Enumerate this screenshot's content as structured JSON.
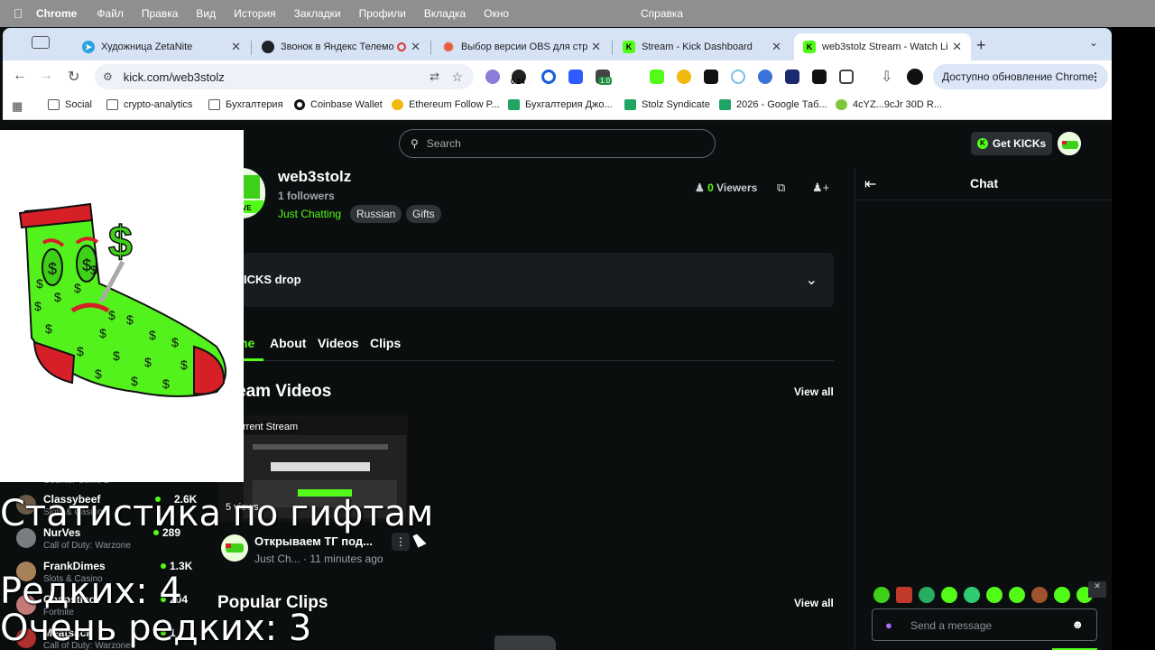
{
  "menubar": {
    "app": "Chrome",
    "items": [
      "Файл",
      "Правка",
      "Вид",
      "История",
      "Закладки",
      "Профили",
      "Вкладка",
      "Окно"
    ],
    "help": "Справка"
  },
  "tabs": [
    {
      "title": "Художница ZetaNite",
      "favicon": "telegram-icon",
      "color": "#2aa3e0"
    },
    {
      "title": "Звонок в Яндекс Телемо",
      "favicon": "yandex-telemost-icon",
      "color": "#202124"
    },
    {
      "title": "Выбор версии OBS для стр",
      "favicon": "asterisk-icon",
      "color": "#e85a3a"
    },
    {
      "title": "Stream - Kick Dashboard",
      "favicon": "kick-icon",
      "color": "#53fc18"
    },
    {
      "title": "web3stolz Stream - Watch Li",
      "favicon": "kick-icon",
      "color": "#53fc18",
      "active": true
    }
  ],
  "toolbar": {
    "url": "kick.com/web3stolz",
    "update_label": "Доступно обновление Chrome",
    "ext_badge_1": "0.24",
    "ext_badge_2": "1.0"
  },
  "bookmarks": [
    "Social",
    "crypto-analytics",
    "Бухгалтерия",
    "Coinbase Wallet",
    "Ethereum Follow P...",
    "Бухгалтерия Джо...",
    "Stolz Syndicate",
    "2026 - Google Таб...",
    "4cYZ...9cJr 30D R..."
  ],
  "kick": {
    "search_placeholder": "Search",
    "get_kicks": "Get KICKs",
    "channel": {
      "name": "web3stolz",
      "followers": "1 followers",
      "category": "Just Chatting",
      "tags": [
        "Russian",
        "Gifts"
      ],
      "viewers_count": "0",
      "viewers_label": "Viewers",
      "live_badge": "VE"
    },
    "drop_title": "ICKS drop",
    "tabs": [
      "me",
      "About",
      "Videos",
      "Clips"
    ],
    "stream_videos_title": "eam Videos",
    "view_all": "View all",
    "video": {
      "badge": "rrent Stream",
      "views": "5 views",
      "title": "Открываем ТГ под...",
      "meta_category": "Just Ch...",
      "meta_time": "11 minutes ago"
    },
    "popular_clips_title": "Popular Clips",
    "sidebar": [
      {
        "name": "Classybeef",
        "category": "Slots & Casino",
        "count": "2.6K"
      },
      {
        "name": "NurVes",
        "category": "Call of Duty: Warzone",
        "count": "289"
      },
      {
        "name": "FrankDimes",
        "category": "Slots & Casino",
        "count": "1.3K"
      },
      {
        "name": "Chapsticc",
        "category": "Fortnite",
        "count": "204"
      },
      {
        "name": "Meatsack",
        "category": "Call of Duty: Warzone",
        "count": "1"
      }
    ],
    "sidebar_top_category": "Counter-Strike 2",
    "chat": {
      "title": "Chat",
      "placeholder": "Send a message"
    }
  },
  "overlay": {
    "line1": "Статистика по гифтам",
    "line2": "Редких: 4",
    "line3": "Очень редких: 3"
  }
}
